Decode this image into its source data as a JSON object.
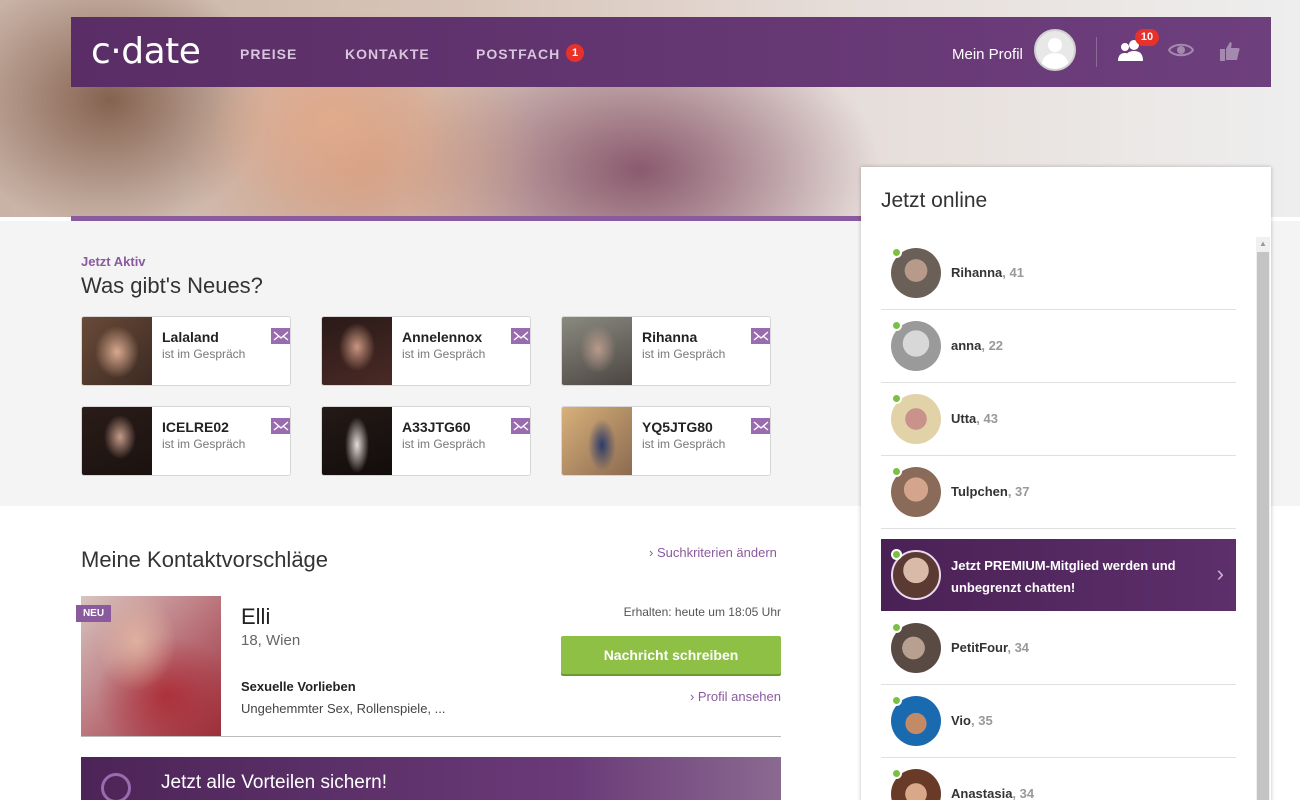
{
  "brand": {
    "logo": "c·date",
    "accent": "#6e3f7d",
    "green": "#8dc044"
  },
  "nav": {
    "links": [
      "PREISE",
      "KONTAKTE",
      "POSTFACH"
    ],
    "postfach_badge": "1",
    "my_profile": "Mein Profil",
    "contacts_badge": "10"
  },
  "activity": {
    "kicker": "Jetzt Aktiv",
    "title": "Was gibt's Neues?",
    "cards": [
      {
        "name": "Lalaland",
        "status": "ist im Gespräch"
      },
      {
        "name": "Annelennox",
        "status": "ist im Gespräch"
      },
      {
        "name": "Rihanna",
        "status": "ist im Gespräch"
      },
      {
        "name": "ICELRE02",
        "status": "ist im Gespräch"
      },
      {
        "name": "A33JTG60",
        "status": "ist im Gespräch"
      },
      {
        "name": "YQ5JTG80",
        "status": "ist im Gespräch"
      }
    ]
  },
  "suggestions": {
    "title": "Meine Kontaktvorschläge",
    "change_criteria": "› Suchkriterien ändern",
    "badge": "NEU",
    "name": "Elli",
    "meta": "18, Wien",
    "received": "Erhalten: heute um 18:05 Uhr",
    "message_button": "Nachricht schreiben",
    "profile_link": "› Profil ansehen",
    "prefs_label": "Sexuelle Vorlieben",
    "prefs_value": "Ungehemmter Sex, Rollenspiele, ..."
  },
  "promo": {
    "text": "Jetzt alle Vorteilen sichern!"
  },
  "online": {
    "title": "Jetzt online",
    "users": [
      {
        "name": "Rihanna",
        "age": ", 41"
      },
      {
        "name": "anna",
        "age": ", 22"
      },
      {
        "name": "Utta",
        "age": ", 43"
      },
      {
        "name": "Tulpchen",
        "age": ", 37"
      },
      {
        "name": "PetitFour",
        "age": ", 34"
      },
      {
        "name": "Vio",
        "age": ", 35"
      },
      {
        "name": "Anastasia",
        "age": ", 34"
      }
    ],
    "premium": "Jetzt PREMIUM-Mitglied werden und unbegrenzt chatten!"
  }
}
